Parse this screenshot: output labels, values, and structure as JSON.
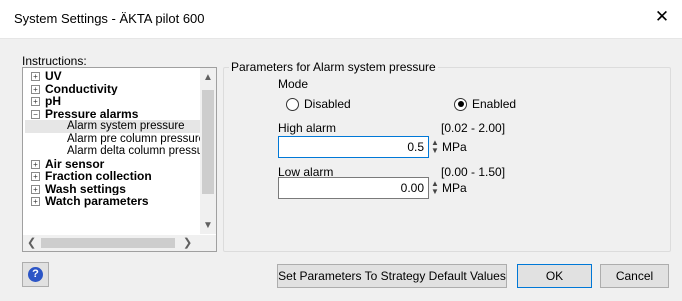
{
  "window": {
    "title": "System Settings - ÄKTA pilot 600",
    "close_glyph": "✕"
  },
  "instructions": {
    "label": "Instructions:",
    "items": [
      {
        "label": "UV",
        "bold": true,
        "expander": "+"
      },
      {
        "label": "Conductivity",
        "bold": true,
        "expander": "+"
      },
      {
        "label": "pH",
        "bold": true,
        "expander": "+"
      },
      {
        "label": "Pressure alarms",
        "bold": true,
        "expander": "−"
      },
      {
        "label": "Alarm system pressure",
        "child": true,
        "selected": true
      },
      {
        "label": "Alarm pre column pressure",
        "child": true
      },
      {
        "label": "Alarm delta column pressur",
        "child": true
      },
      {
        "label": "Air sensor",
        "bold": true,
        "expander": "+"
      },
      {
        "label": "Fraction collection",
        "bold": true,
        "expander": "+"
      },
      {
        "label": "Wash settings",
        "bold": true,
        "expander": "+"
      },
      {
        "label": "Watch parameters",
        "bold": true,
        "expander": "+"
      }
    ]
  },
  "parameters": {
    "group_title": "Parameters for Alarm system pressure",
    "mode_label": "Mode",
    "mode_options": [
      "Disabled",
      "Enabled"
    ],
    "mode_selected": "Enabled",
    "high_alarm": {
      "label": "High alarm",
      "range": "[0.02 - 2.00]",
      "value": "0.5",
      "unit": "MPa"
    },
    "low_alarm": {
      "label": "Low alarm",
      "range": "[0.00 - 1.50]",
      "value": "0.00",
      "unit": "MPa"
    }
  },
  "footer": {
    "strategy_button": "Set Parameters To Strategy Default Values",
    "ok": "OK",
    "cancel": "Cancel",
    "help_glyph": "?"
  }
}
